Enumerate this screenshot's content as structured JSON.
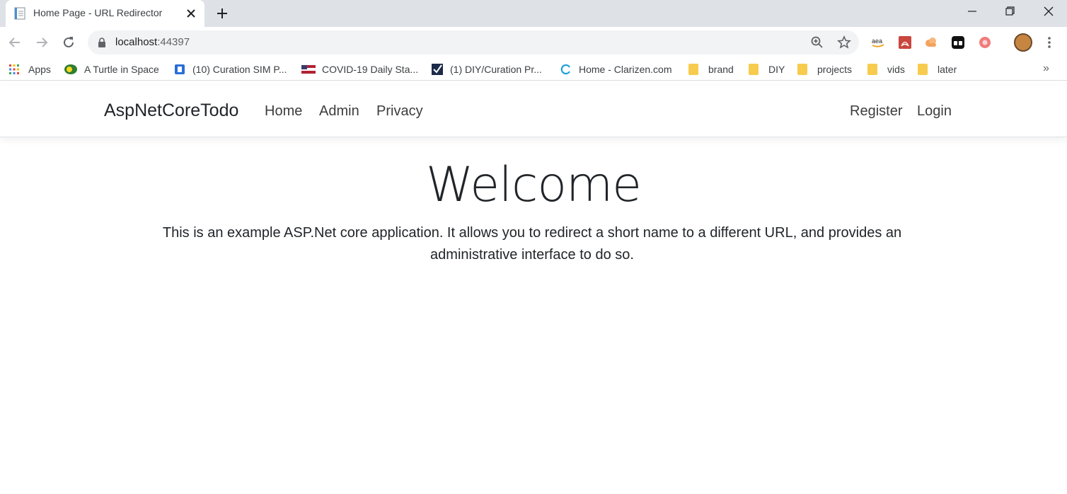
{
  "browser": {
    "tab_title": "Home Page - URL Redirector",
    "url_host": "localhost",
    "url_port": ":44397",
    "icons": [
      "page-icon",
      "close-icon",
      "plus-icon",
      "minimize-icon",
      "restore-icon",
      "close-window-icon",
      "back-icon",
      "forward-icon",
      "reload-icon",
      "lock-icon",
      "zoom-icon",
      "star-icon",
      "amazon-icon",
      "pdf-icon",
      "cloud-icon",
      "extension-icon",
      "record-icon",
      "avatar",
      "menu-icon"
    ],
    "bookmarks": {
      "apps": "Apps",
      "turtle": "A Turtle in Space",
      "curation_sim": "(10) Curation SIM P...",
      "covid": "COVID-19 Daily Sta...",
      "diy_curation": "(1) DIY/Curation Pr...",
      "clarizen": "Home - Clarizen.com",
      "brand": "brand",
      "diy": "DIY",
      "projects": "projects",
      "vids": "vids",
      "later": "later",
      "more": "»"
    }
  },
  "site": {
    "brand": "AspNetCoreTodo",
    "nav": {
      "home": "Home",
      "admin": "Admin",
      "privacy": "Privacy",
      "register": "Register",
      "login": "Login"
    }
  },
  "main": {
    "title": "Welcome",
    "text": "This is an example ASP.Net core application. It allows you to redirect a short name to a different URL, and provides an administrative interface to do so."
  },
  "colors": {
    "tabstrip": "#dee1e6",
    "omnibox": "#f1f3f4",
    "folder": "#f7cb4d",
    "text": "#212529"
  }
}
